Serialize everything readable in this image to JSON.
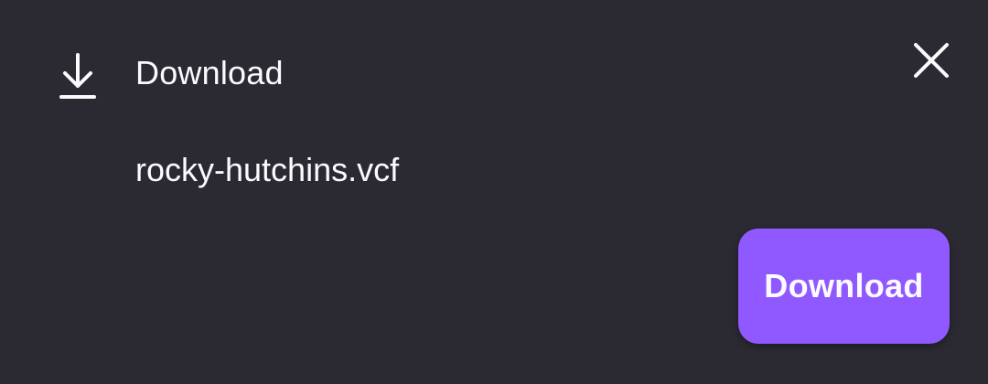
{
  "dialog": {
    "title": "Download",
    "icons": {
      "header_icon": "download-icon",
      "close": "close-icon"
    },
    "file_name": "rocky-hutchins.vcf",
    "primary_button_label": "Download"
  },
  "colors": {
    "background": "#2b2a33",
    "text": "#fbfbfe",
    "accent": "#9059ff"
  }
}
